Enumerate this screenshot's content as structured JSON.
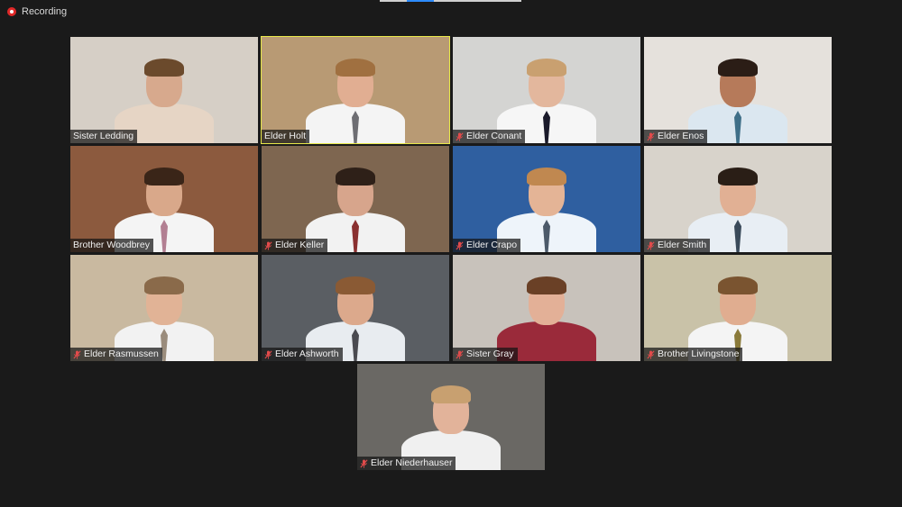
{
  "recording": {
    "label": "Recording",
    "color": "#e02828"
  },
  "tiles": [
    {
      "name": "Sister Ledding",
      "muted": false,
      "active": false,
      "bg": "#d6cfc6",
      "skin": "#d7a98d",
      "hair": "#6b4a2c",
      "body": "#e6d5c5",
      "tie": ""
    },
    {
      "name": "Elder Holt",
      "muted": false,
      "active": true,
      "bg": "#b89a74",
      "skin": "#e1ae92",
      "hair": "#a07040",
      "body": "#f4f4f4",
      "tie": "#6d6d72"
    },
    {
      "name": "Elder Conant",
      "muted": true,
      "active": false,
      "bg": "#d4d4d2",
      "skin": "#e3b79d",
      "hair": "#c9a070",
      "body": "#f6f6f6",
      "tie": "#1a1a2a"
    },
    {
      "name": "Elder Enos",
      "muted": true,
      "active": false,
      "bg": "#e5e1dc",
      "skin": "#b67a5a",
      "hair": "#2b1d16",
      "body": "#dbe7f0",
      "tie": "#3f6f88"
    },
    {
      "name": "Brother Woodbrey",
      "muted": false,
      "active": false,
      "bg": "#8c5a3e",
      "skin": "#d9a88a",
      "hair": "#3a2518",
      "body": "#f4f4f4",
      "tie": "#b27f92"
    },
    {
      "name": "Elder Keller",
      "muted": true,
      "active": false,
      "bg": "#7e6650",
      "skin": "#d7a58c",
      "hair": "#2e2018",
      "body": "#f2f2f2",
      "tie": "#8a3030"
    },
    {
      "name": "Elder Crapo",
      "muted": true,
      "active": false,
      "bg": "#2f5fa0",
      "skin": "#e4b496",
      "hair": "#c08850",
      "body": "#eef4fa",
      "tie": "#4c5a6a"
    },
    {
      "name": "Elder Smith",
      "muted": true,
      "active": false,
      "bg": "#d8d3cb",
      "skin": "#e1b094",
      "hair": "#2a1e16",
      "body": "#e8eef4",
      "tie": "#3a4a5a"
    },
    {
      "name": "Elder Rasmussen",
      "muted": true,
      "active": false,
      "bg": "#c9b9a0",
      "skin": "#e1b396",
      "hair": "#8a6a4a",
      "body": "#f2f2f2",
      "tie": "#9a8c7c"
    },
    {
      "name": "Elder Ashworth",
      "muted": true,
      "active": false,
      "bg": "#5a5e63",
      "skin": "#dca98c",
      "hair": "#8a5a34",
      "body": "#e8ecf0",
      "tie": "#4a4a50"
    },
    {
      "name": "Sister Gray",
      "muted": true,
      "active": false,
      "bg": "#c8c2bb",
      "skin": "#e3b097",
      "hair": "#6a4026",
      "body": "#9a2a3a",
      "tie": ""
    },
    {
      "name": "Brother Livingstone",
      "muted": true,
      "active": false,
      "bg": "#c9c2a8",
      "skin": "#e0ad90",
      "hair": "#7a5430",
      "body": "#f4f4f4",
      "tie": "#8a7a3a"
    },
    {
      "name": "Elder Niederhauser",
      "muted": true,
      "active": false,
      "bg": "#6a6864",
      "skin": "#e2b39a",
      "hair": "#c8a070",
      "body": "#f0f0f0",
      "tie": ""
    }
  ]
}
